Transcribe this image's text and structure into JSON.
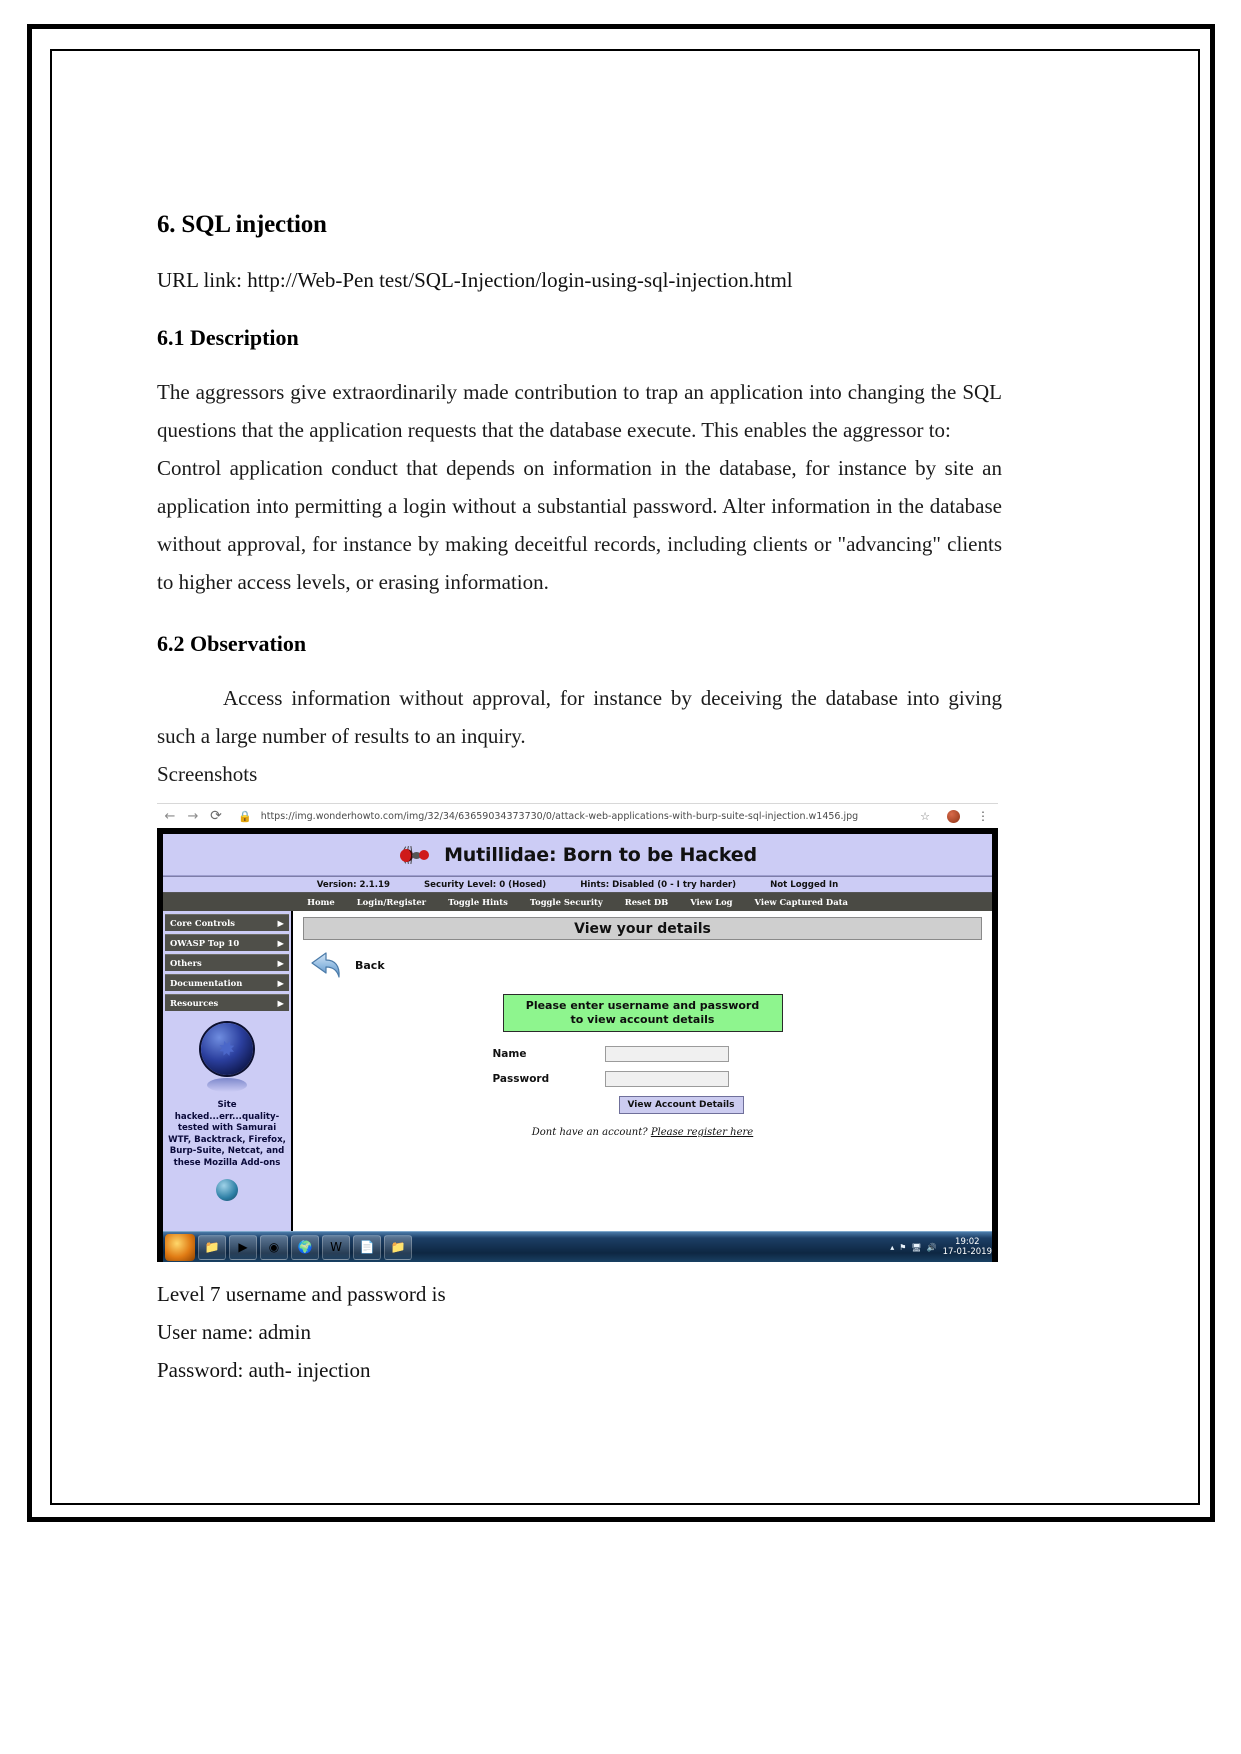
{
  "document": {
    "heading": "6. SQL injection",
    "url_line": "URL link: http://Web-Pen test/SQL-Injection/login-using-sql-injection.html",
    "section_description_title": "6.1 Description",
    "description_p1": "The aggressors give extraordinarily made contribution to trap an application into changing the SQL questions that the application requests that the database execute. This enables the aggressor to:",
    "description_p2": "Control application conduct that depends on information in the database, for instance by site an application into permitting a login without a substantial password. Alter information in the database without approval, for instance by making deceitful records, including clients or \"advancing\" clients to higher access levels, or erasing information.",
    "section_observation_title": "6.2 Observation",
    "observation_p1": "Access information without approval, for instance by deceiving the database into giving such a large number of results to an inquiry.",
    "screenshots_label": "Screenshots",
    "footer_line_1": "Level 7 username and password is",
    "footer_line_2": "User name: admin",
    "footer_line_3": "Password: auth- injection"
  },
  "browser": {
    "back_icon": "←",
    "forward_icon": "→",
    "reload_icon": "⟳",
    "lock_icon": "🔒",
    "url": "https://img.wonderhowto.com/img/32/34/63659034373730/0/attack-web-applications-with-burp-suite-sql-injection.w1456.jpg",
    "star_icon": "☆",
    "menu_icon": "⋮"
  },
  "mutillidae": {
    "title": "Mutillidae: Born to be Hacked",
    "status": {
      "version": "Version: 2.1.19",
      "security_level": "Security Level: 0 (Hosed)",
      "hints": "Hints: Disabled (0 - I try harder)",
      "login_state": "Not Logged In"
    },
    "nav": [
      "Home",
      "Login/Register",
      "Toggle Hints",
      "Toggle Security",
      "Reset DB",
      "View Log",
      "View Captured Data"
    ],
    "sidebar": {
      "items": [
        {
          "label": "Core Controls",
          "arrow": "▶"
        },
        {
          "label": "OWASP Top 10",
          "arrow": "▶"
        },
        {
          "label": "Others",
          "arrow": "▶"
        },
        {
          "label": "Documentation",
          "arrow": "▶"
        },
        {
          "label": "Resources",
          "arrow": "▶"
        }
      ],
      "promo_text": "Site hacked...err...quality-tested with Samurai WTF, Backtrack, Firefox, Burp-Suite, Netcat, and these Mozilla Add-ons"
    },
    "page": {
      "title": "View your details",
      "back_label": "Back",
      "hint_line_1": "Please enter username and password",
      "hint_line_2": "to view account details",
      "name_label": "Name",
      "name_value": "",
      "password_label": "Password",
      "password_value": "",
      "submit_label": "View Account Details",
      "register_prompt": "Dont have an account?",
      "register_link": "Please register here"
    }
  },
  "taskbar": {
    "items": [
      "🌐",
      "📁",
      "▶",
      "◉",
      "🌍",
      "W",
      "📄",
      "📁"
    ],
    "tray": [
      "▴",
      "⚑",
      "🖥",
      "🔊"
    ],
    "time": "19:02",
    "date": "17-01-2019"
  },
  "colors": {
    "mutillidae_header_bg": "#ccccf5",
    "nav_bg": "#4a4a44",
    "hint_green": "#8ef58e",
    "page_title_bg": "#cfcfcf"
  }
}
